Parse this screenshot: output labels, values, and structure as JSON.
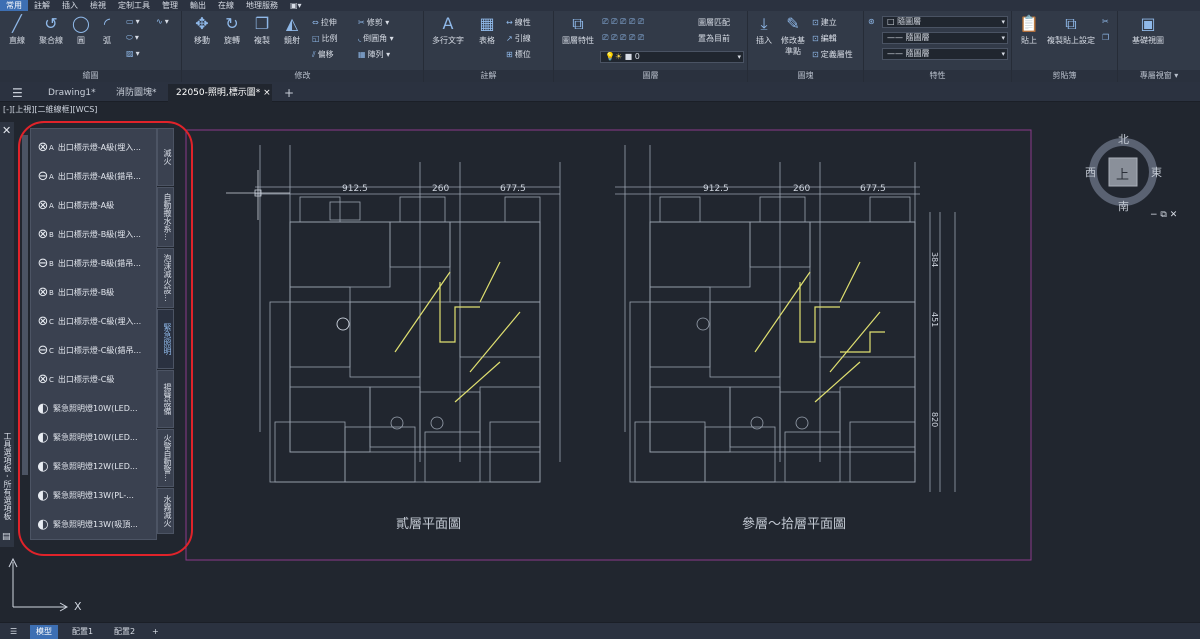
{
  "menu": [
    "常用",
    "註解",
    "插入",
    "檢視",
    "定制工具",
    "管理",
    "輸出",
    "在線",
    "地理服務"
  ],
  "ribbon": {
    "draw": {
      "title": "繪圖",
      "line": "直線",
      "polyline": "聚合線",
      "circle": "圓",
      "arc": "弧"
    },
    "modify": {
      "title": "修改",
      "move": "移動",
      "rotate": "旋轉",
      "copy": "複製",
      "mirror": "鏡射",
      "stretch": "拉伸",
      "scale": "比例",
      "offset": "偏移",
      "trim": "修剪",
      "fillet": "倒圓角",
      "array": "陣列"
    },
    "annotation": {
      "title": "註解",
      "mtext": "多行文字",
      "table": "表格",
      "linear": "線性",
      "leader": "引線",
      "position": "標位"
    },
    "layers": {
      "title": "圖層",
      "props": "圖層特性",
      "match": "圖層匹配",
      "current": "置為目前",
      "current_layer": "0"
    },
    "block": {
      "title": "圖塊",
      "insert": "插入",
      "edit_base": "修改基準點",
      "create": "建立",
      "edit": "編輯",
      "edit_attr": "定義屬性"
    },
    "properties": {
      "title": "特性",
      "color": "隨圖層",
      "linetype": "隨圖層",
      "lineweight": "隨圖層"
    },
    "clipboard": {
      "title": "剪貼簿",
      "paste": "貼上",
      "paste_special": "複製貼上設定"
    },
    "view": {
      "title": "專屬視窗",
      "base": "基礎視圖"
    }
  },
  "doc_tabs": [
    "Drawing1*",
    "消防圖塊*",
    "22050-照明,標示圖*"
  ],
  "view_label": "[-][上視][二維線框][WCS]",
  "palette_items": [
    {
      "icon": "⊗",
      "sub": "A",
      "label": "出口標示燈-A級(埋入..."
    },
    {
      "icon": "⊖",
      "sub": "A",
      "label": "出口標示燈-A級(錯吊..."
    },
    {
      "icon": "⊗",
      "sub": "A",
      "label": "出口標示燈-A級"
    },
    {
      "icon": "⊗",
      "sub": "B",
      "label": "出口標示燈-B級(埋入..."
    },
    {
      "icon": "⊖",
      "sub": "B",
      "label": "出口標示燈-B級(錯吊..."
    },
    {
      "icon": "⊗",
      "sub": "B",
      "label": "出口標示燈-B級"
    },
    {
      "icon": "⊗",
      "sub": "C",
      "label": "出口標示燈-C級(埋入..."
    },
    {
      "icon": "⊖",
      "sub": "C",
      "label": "出口標示燈-C級(錯吊..."
    },
    {
      "icon": "⊗",
      "sub": "C",
      "label": "出口標示燈-C級"
    },
    {
      "icon": "◐",
      "sub": "",
      "label": "緊急照明燈10W(LED..."
    },
    {
      "icon": "◐",
      "sub": "",
      "label": "緊急照明燈10W(LED..."
    },
    {
      "icon": "◐",
      "sub": "",
      "label": "緊急照明燈12W(LED..."
    },
    {
      "icon": "◐",
      "sub": "",
      "label": "緊急照明燈13W(PL-..."
    },
    {
      "icon": "◐",
      "sub": "",
      "label": "緊急照明燈13W(吸頂..."
    }
  ],
  "vtabs": [
    "滅火",
    "自動撒水系...",
    "泡沫滅火設...",
    "緊急照明",
    "揚聲設備",
    "火警自動警...",
    "水霧滅火"
  ],
  "compass": {
    "n": "北",
    "s": "南",
    "e": "東",
    "w": "西",
    "top": "上"
  },
  "plans": [
    {
      "title": "貳層平面圖",
      "dims": [
        "912.5",
        "260",
        "677.5"
      ]
    },
    {
      "title": "參層～拾層平面圖",
      "dims": [
        "912.5",
        "260",
        "677.5"
      ]
    }
  ],
  "side_dims": [
    "384",
    "451",
    "820"
  ],
  "status_tabs": [
    "模型",
    "配置1",
    "配置2",
    "+"
  ],
  "left_vtext": "工具選項板 - 所有選項板",
  "axis_x": "X"
}
